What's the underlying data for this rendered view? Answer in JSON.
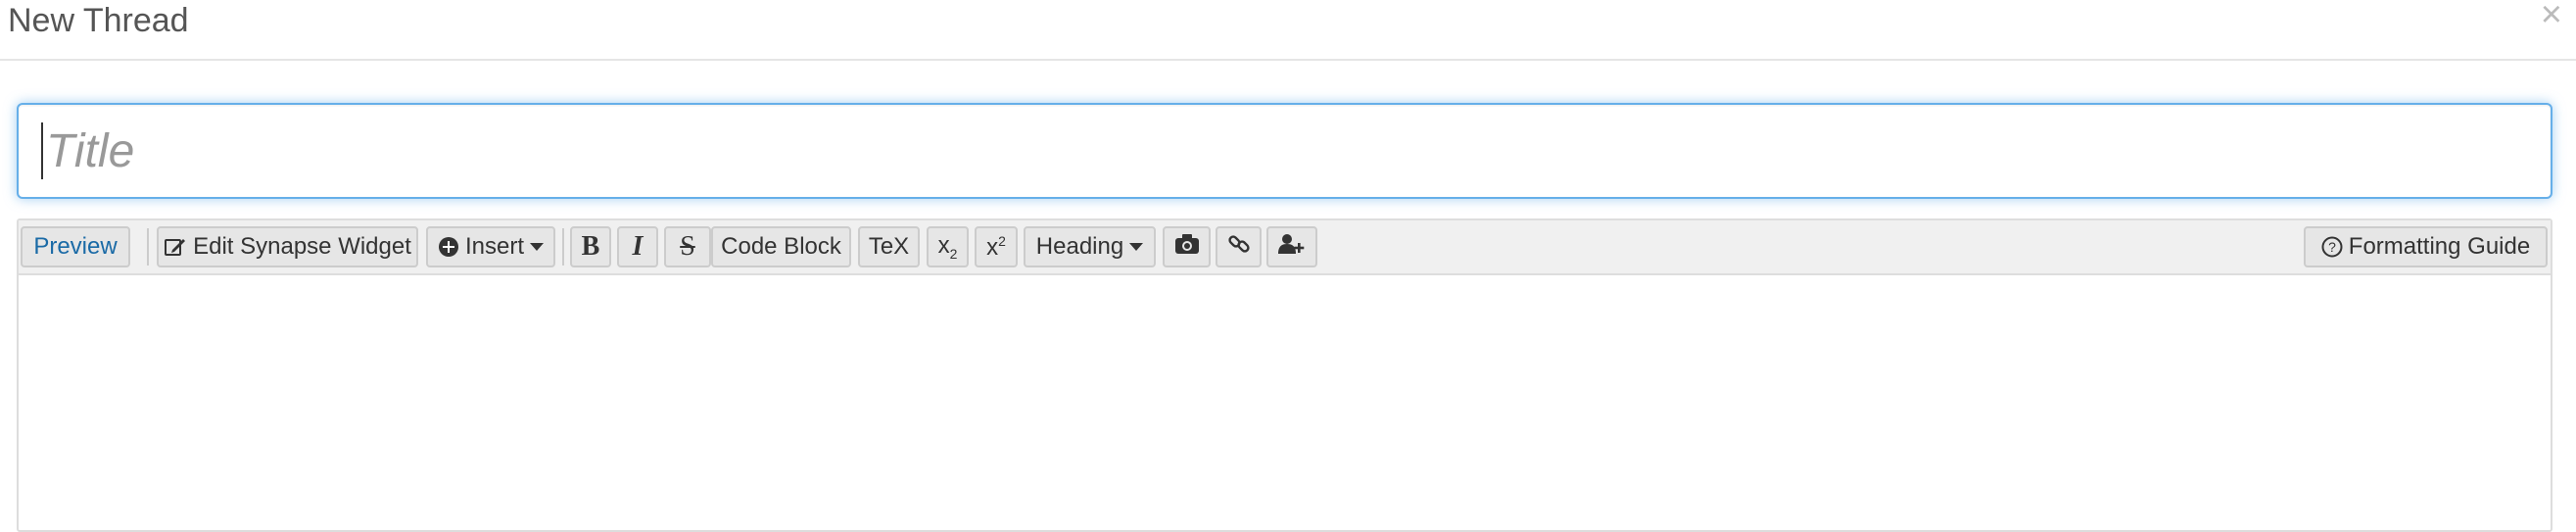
{
  "dialog": {
    "title": "New Thread",
    "close_symbol": "×"
  },
  "title_field": {
    "placeholder": "Title",
    "value": ""
  },
  "toolbar": {
    "preview": "Preview",
    "edit_widget": "Edit Synapse Widget",
    "insert": "Insert",
    "bold": "B",
    "italic": "I",
    "strike": "S",
    "code_block": "Code Block",
    "tex": "TeX",
    "subscript_base": "x",
    "subscript_mark": "2",
    "superscript_base": "x",
    "superscript_mark": "2",
    "heading": "Heading",
    "formatting_guide": "Formatting Guide"
  },
  "colors": {
    "focus_border": "#66afe9",
    "preview_text": "#1a6aa6"
  }
}
